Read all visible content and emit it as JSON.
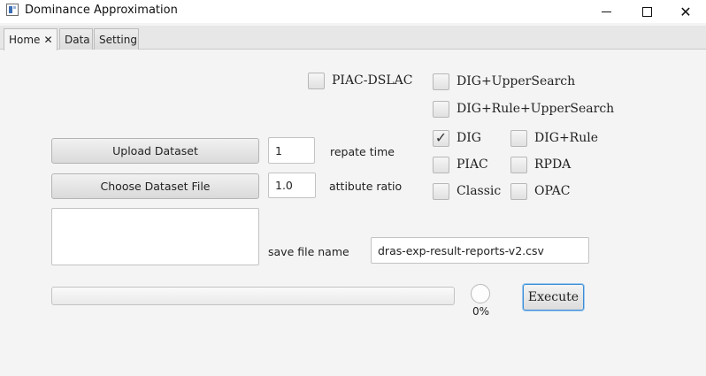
{
  "window": {
    "title": "Dominance Approximation",
    "minimize": "—",
    "maximize": "☐",
    "close": "✕"
  },
  "tabs": [
    {
      "label": "Home",
      "close": "✕",
      "active": true
    },
    {
      "label": "Data",
      "active": false
    },
    {
      "label": "Setting",
      "active": false
    }
  ],
  "buttons": {
    "upload_dataset": "Upload Dataset",
    "choose_dataset_file": "Choose Dataset File",
    "execute": "Execute"
  },
  "inputs": {
    "repeat_time": {
      "value": "1",
      "label": "repate time"
    },
    "attribute_ratio": {
      "value": "1.0",
      "label": "attibute ratio"
    },
    "save_file_name": {
      "value": "dras-exp-result-reports-v2.csv",
      "label": "save file name"
    }
  },
  "algorithms": [
    {
      "label": "PIAC-DSLAC",
      "checked": false
    },
    {
      "label": "DIG+UpperSearch",
      "checked": false
    },
    {
      "label": "DIG+Rule+UpperSearch",
      "checked": false
    },
    {
      "label": "DIG",
      "checked": true
    },
    {
      "label": "DIG+Rule",
      "checked": false
    },
    {
      "label": "PIAC",
      "checked": false
    },
    {
      "label": "RPDA",
      "checked": false
    },
    {
      "label": "Classic",
      "checked": false
    },
    {
      "label": "OPAC",
      "checked": false
    }
  ],
  "progress": {
    "value": 0,
    "text": "0%"
  },
  "check_mark": "✓",
  "colors": {
    "accent_focus": "#3b8cd6",
    "background": "#f4f4f4"
  }
}
